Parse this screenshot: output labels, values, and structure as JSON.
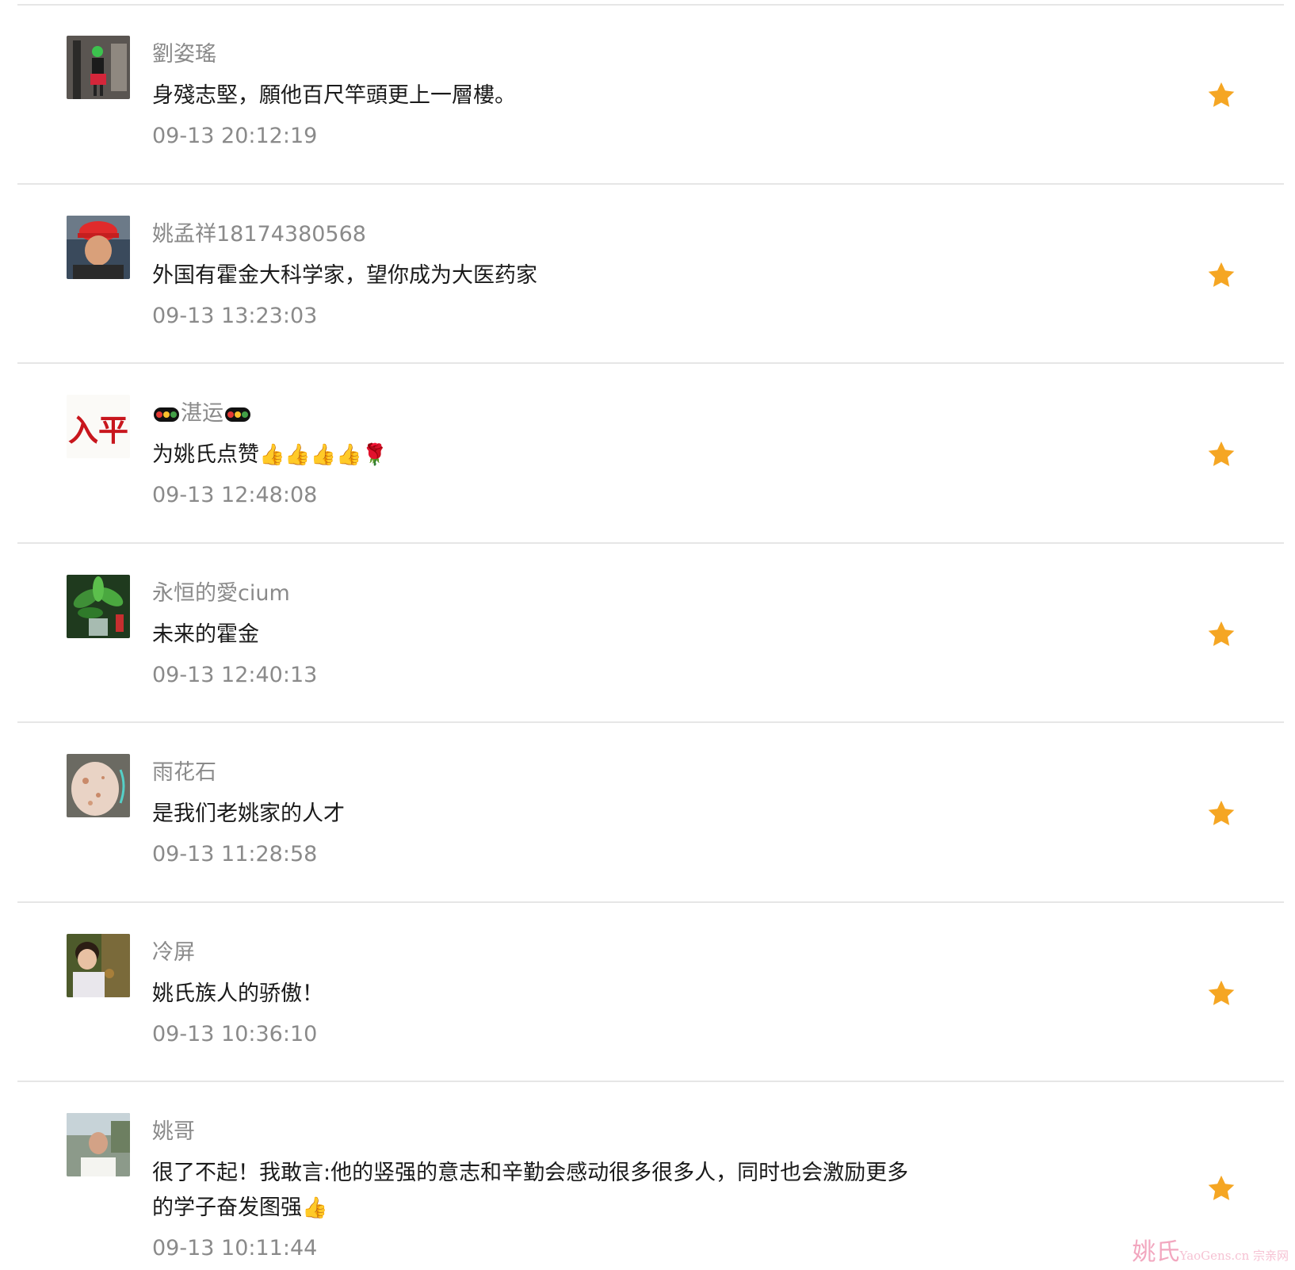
{
  "comments": [
    {
      "name": "劉姿瑤",
      "text": "身殘志堅，願他百尺竿頭更上一層樓。",
      "time": "09-13 20:12:19"
    },
    {
      "name": "姚孟祥18174380568",
      "text": "外国有霍金大科学家，望你成为大医药家",
      "time": "09-13 13:23:03"
    },
    {
      "name": "湛运",
      "text": "为姚氏点赞",
      "emoji": "👍👍👍👍🌹",
      "time": "09-13 12:48:08"
    },
    {
      "name": "永恒的愛cium",
      "text": "未来的霍金",
      "time": "09-13 12:40:13"
    },
    {
      "name": "雨花石",
      "text": "是我们老姚家的人才",
      "time": "09-13 11:28:58"
    },
    {
      "name": "冷屏",
      "text": "姚氏族人的骄傲！",
      "time": "09-13 10:36:10"
    },
    {
      "name": "姚哥",
      "text": "很了不起！我敢言:他的竖强的意志和辛勤会感动很多很多人，同时也会激励更多的学子奋发图强",
      "emoji": "👍",
      "time": "09-13 10:11:44"
    }
  ],
  "avatar_3_text": "出入平安",
  "watermark": {
    "main": "姚氏",
    "sub": "YaoGens.cn 宗亲网"
  },
  "colors": {
    "star": "#F5A623",
    "divider": "#E6E6E6",
    "meta": "#8A8A8A"
  }
}
